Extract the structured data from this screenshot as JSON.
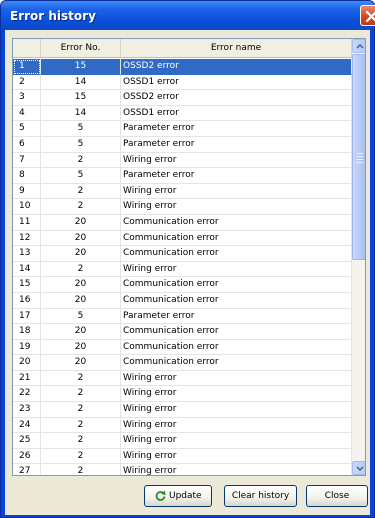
{
  "window": {
    "title": "Error history"
  },
  "table": {
    "columns": [
      "",
      "Error No.",
      "Error name"
    ],
    "rows": [
      {
        "index": "1",
        "error_no": "15",
        "error_name": "OSSD2 error"
      },
      {
        "index": "2",
        "error_no": "14",
        "error_name": "OSSD1 error"
      },
      {
        "index": "3",
        "error_no": "15",
        "error_name": "OSSD2 error"
      },
      {
        "index": "4",
        "error_no": "14",
        "error_name": "OSSD1 error"
      },
      {
        "index": "5",
        "error_no": "5",
        "error_name": "Parameter error"
      },
      {
        "index": "6",
        "error_no": "5",
        "error_name": "Parameter error"
      },
      {
        "index": "7",
        "error_no": "2",
        "error_name": "Wiring error"
      },
      {
        "index": "8",
        "error_no": "5",
        "error_name": "Parameter error"
      },
      {
        "index": "9",
        "error_no": "2",
        "error_name": "Wiring error"
      },
      {
        "index": "10",
        "error_no": "2",
        "error_name": "Wiring error"
      },
      {
        "index": "11",
        "error_no": "20",
        "error_name": "Communication error"
      },
      {
        "index": "12",
        "error_no": "20",
        "error_name": "Communication error"
      },
      {
        "index": "13",
        "error_no": "20",
        "error_name": "Communication error"
      },
      {
        "index": "14",
        "error_no": "2",
        "error_name": "Wiring error"
      },
      {
        "index": "15",
        "error_no": "20",
        "error_name": "Communication error"
      },
      {
        "index": "16",
        "error_no": "20",
        "error_name": "Communication error"
      },
      {
        "index": "17",
        "error_no": "5",
        "error_name": "Parameter error"
      },
      {
        "index": "18",
        "error_no": "20",
        "error_name": "Communication error"
      },
      {
        "index": "19",
        "error_no": "20",
        "error_name": "Communication error"
      },
      {
        "index": "20",
        "error_no": "20",
        "error_name": "Communication error"
      },
      {
        "index": "21",
        "error_no": "2",
        "error_name": "Wiring error"
      },
      {
        "index": "22",
        "error_no": "2",
        "error_name": "Wiring error"
      },
      {
        "index": "23",
        "error_no": "2",
        "error_name": "Wiring error"
      },
      {
        "index": "24",
        "error_no": "2",
        "error_name": "Wiring error"
      },
      {
        "index": "25",
        "error_no": "2",
        "error_name": "Wiring error"
      },
      {
        "index": "26",
        "error_no": "2",
        "error_name": "Wiring error"
      },
      {
        "index": "27",
        "error_no": "2",
        "error_name": "Wiring error"
      }
    ],
    "selected_row": 0
  },
  "buttons": {
    "update": "Update",
    "clear_history": "Clear history",
    "close": "Close"
  },
  "icons": {
    "title_close": "close-icon",
    "update": "refresh-icon",
    "scroll_up": "chevron-up-icon",
    "scroll_down": "chevron-down-icon"
  },
  "colors": {
    "title_bar": "#0b4fd9",
    "selection": "#316ac5",
    "close_button": "#d24a2a",
    "dialog_face": "#ece9d8"
  }
}
